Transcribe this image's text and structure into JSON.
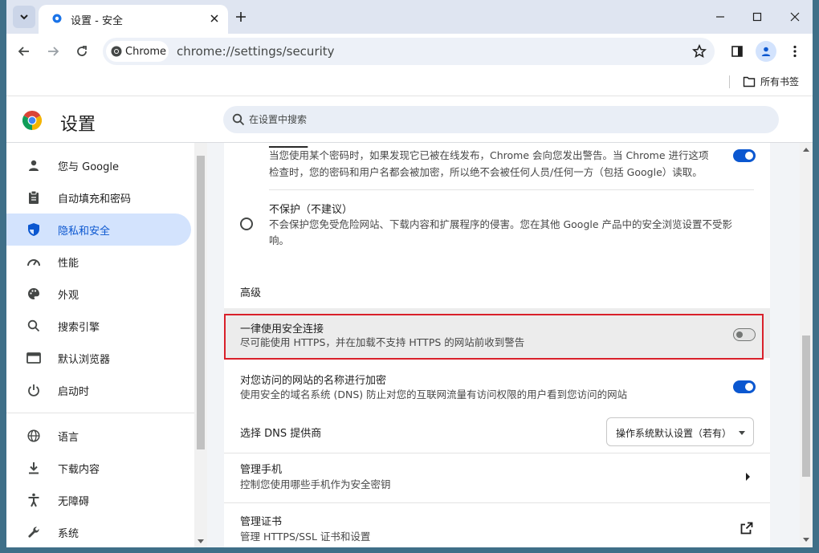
{
  "tab": {
    "title": "设置 - 安全",
    "close_icon": "close-icon",
    "icon": "gear-icon"
  },
  "toolbar": {
    "chip_label": "Chrome",
    "url": "chrome://settings/security"
  },
  "bookmarks": {
    "all_bookmarks": "所有书签"
  },
  "settings": {
    "title": "设置",
    "search_placeholder": "在设置中搜索"
  },
  "sidebar": {
    "items": [
      {
        "label": "您与 Google",
        "icon": "person-icon"
      },
      {
        "label": "自动填充和密码",
        "icon": "clipboard-icon"
      },
      {
        "label": "隐私和安全",
        "icon": "shield-icon",
        "active": true
      },
      {
        "label": "性能",
        "icon": "speedometer-icon"
      },
      {
        "label": "外观",
        "icon": "palette-icon"
      },
      {
        "label": "搜索引擎",
        "icon": "search-icon"
      },
      {
        "label": "默认浏览器",
        "icon": "browser-icon"
      },
      {
        "label": "启动时",
        "icon": "power-icon"
      },
      {
        "label": "语言",
        "icon": "globe-icon"
      },
      {
        "label": "下载内容",
        "icon": "download-icon"
      },
      {
        "label": "无障碍",
        "icon": "accessibility-icon"
      },
      {
        "label": "系统",
        "icon": "wrench-icon"
      }
    ]
  },
  "main": {
    "password_warning": {
      "desc_line1": "当您使用某个密码时，如果发现它已被在线发布，Chrome 会向您发出警告。当 Chrome 进行这项",
      "desc_line2": "检查时，您的密码和用户名都会被加密，所以绝不会被任何人员/任何一方（包括 Google）读取。",
      "enabled": true
    },
    "no_protection": {
      "title": "不保护（不建议）",
      "desc_line1": "不会保护您免受危险网站、下载内容和扩展程序的侵害。您在其他 Google 产品中的安全浏览设置不受影",
      "desc_line2": "响。"
    },
    "advanced_heading": "高级",
    "https_only": {
      "title": "一律使用安全连接",
      "desc": "尽可能使用 HTTPS，并在加载不支持 HTTPS 的网站前收到警告",
      "enabled": false
    },
    "secure_dns": {
      "title": "对您访问的网站的名称进行加密",
      "desc": "使用安全的域名系统 (DNS) 防止对您的互联网流量有访问权限的用户看到您访问的网站",
      "enabled": true
    },
    "dns_provider": {
      "label": "选择 DNS 提供商",
      "selected": "操作系统默认设置（若有）"
    },
    "manage_phones": {
      "title": "管理手机",
      "desc": "控制您使用哪些手机作为安全密钥"
    },
    "manage_certs": {
      "title": "管理证书",
      "desc": "管理 HTTPS/SSL 证书和设置"
    }
  },
  "colors": {
    "accent": "#0b57d0",
    "highlight_border": "#d9202a",
    "active_nav_bg": "#d3e3fd"
  }
}
